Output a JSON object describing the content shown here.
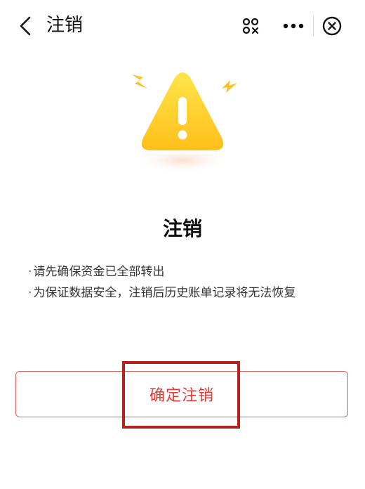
{
  "header": {
    "title": "注销",
    "icons": [
      "back-arrow-icon",
      "mini-program-icon",
      "more-icon",
      "close-icon"
    ]
  },
  "content": {
    "title": "注销",
    "tips": [
      "请先确保资金已全部转出",
      "为保证数据安全，注销后历史账单记录将无法恢复"
    ],
    "tip_bullet": "·"
  },
  "actions": {
    "confirm_label": "确定注销"
  },
  "colors": {
    "accent": "#e53935",
    "warning_yellow": "#ffd21a",
    "highlight_box": "#b5211b"
  }
}
